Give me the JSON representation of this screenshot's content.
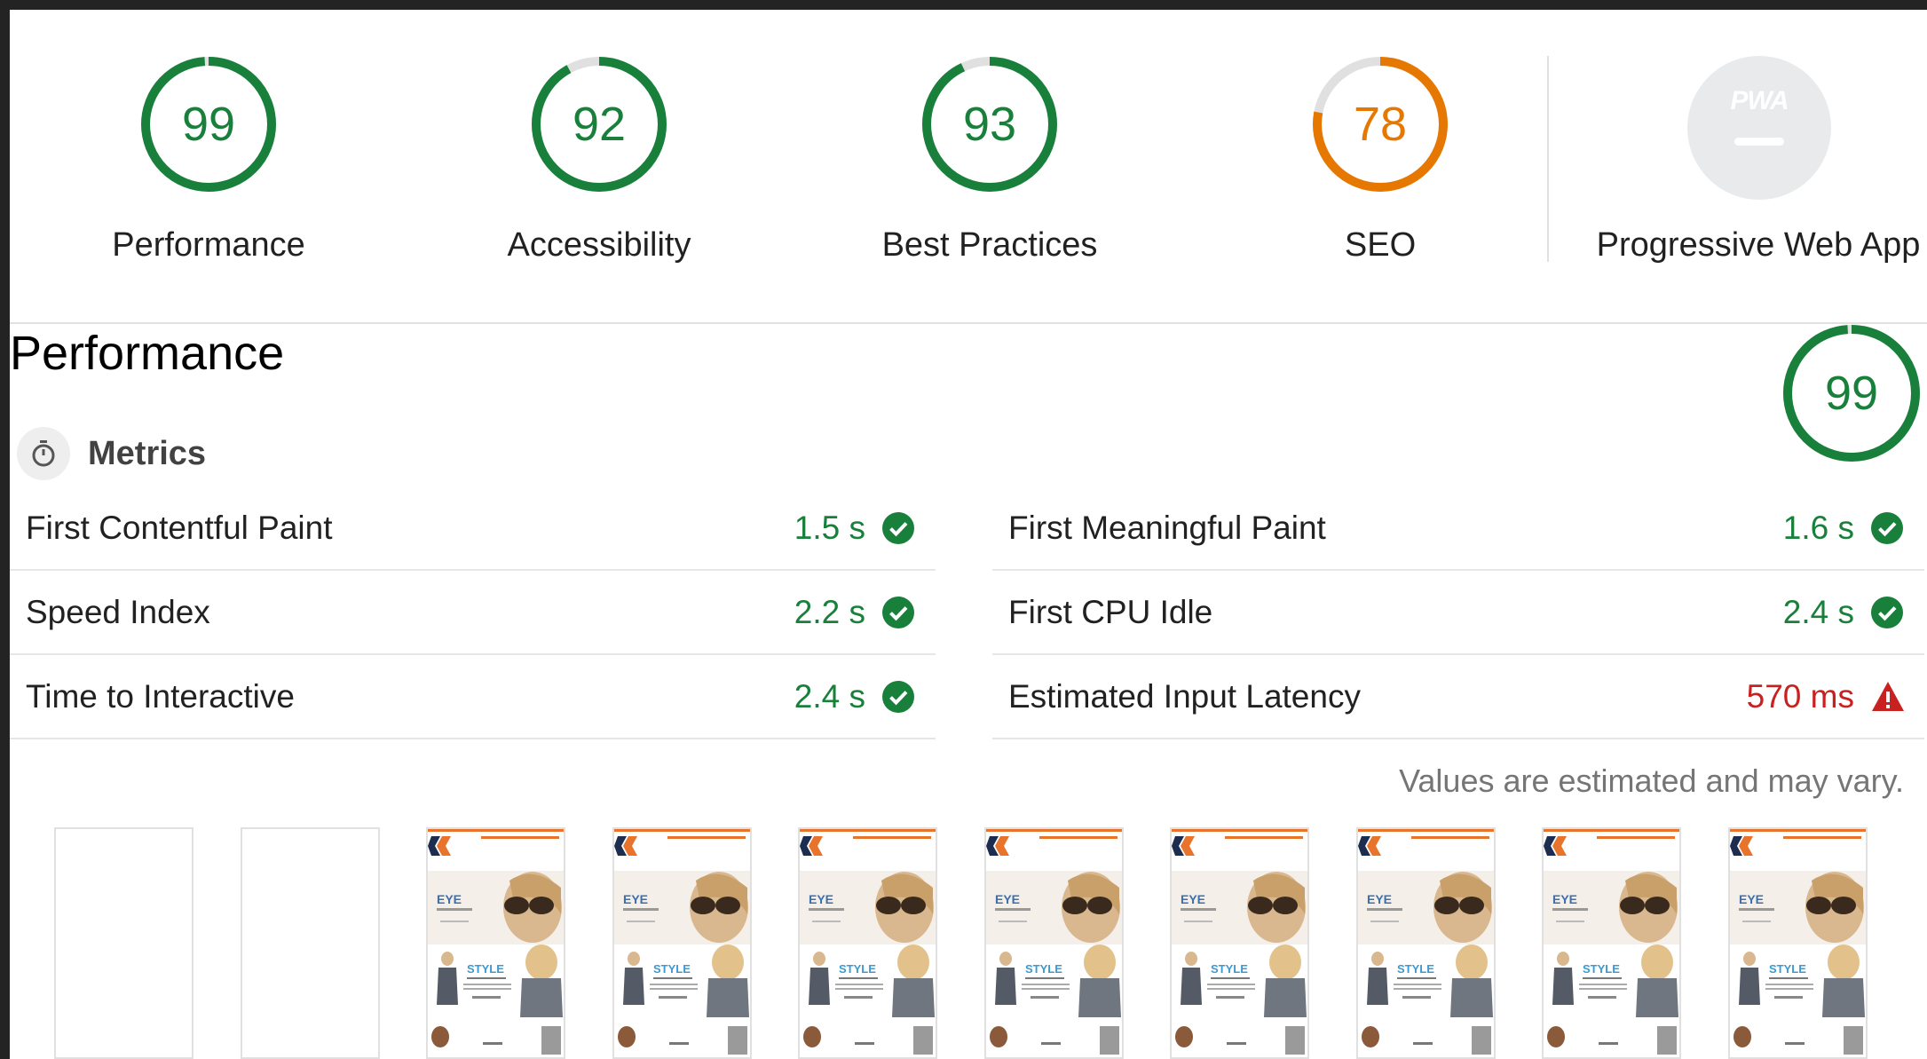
{
  "categories": [
    {
      "score": "99",
      "label": "Performance",
      "fraction": 0.99,
      "color": "#18803a"
    },
    {
      "score": "92",
      "label": "Accessibility",
      "fraction": 0.92,
      "color": "#18803a"
    },
    {
      "score": "93",
      "label": "Best Practices",
      "fraction": 0.93,
      "color": "#18803a"
    },
    {
      "score": "78",
      "label": "SEO",
      "fraction": 0.78,
      "color": "#e67700"
    }
  ],
  "pwa": {
    "badge_text": "PWA",
    "label": "Progressive Web App"
  },
  "performance": {
    "title": "Performance",
    "score": "99",
    "fraction": 0.99,
    "color": "#18803a"
  },
  "metrics": {
    "title": "Metrics",
    "items": [
      {
        "label": "First Contentful Paint",
        "value": "1.5 s",
        "status": "pass"
      },
      {
        "label": "First Meaningful Paint",
        "value": "1.6 s",
        "status": "pass"
      },
      {
        "label": "Speed Index",
        "value": "2.2 s",
        "status": "pass"
      },
      {
        "label": "First CPU Idle",
        "value": "2.4 s",
        "status": "pass"
      },
      {
        "label": "Time to Interactive",
        "value": "2.4 s",
        "status": "pass"
      },
      {
        "label": "Estimated Input Latency",
        "value": "570 ms",
        "status": "fail"
      }
    ],
    "disclaimer": "Values are estimated and may vary."
  },
  "colors": {
    "pass": "#18803a",
    "average": "#e67700",
    "fail": "#c7221f",
    "track": "#e0e0e0"
  },
  "filmstrip": {
    "frames": [
      "blank",
      "blank",
      "loaded",
      "loaded",
      "loaded",
      "loaded",
      "loaded",
      "loaded",
      "loaded",
      "loaded"
    ],
    "thumb_texts": {
      "eye_line": "EYE",
      "style_line": "STYLE"
    }
  }
}
